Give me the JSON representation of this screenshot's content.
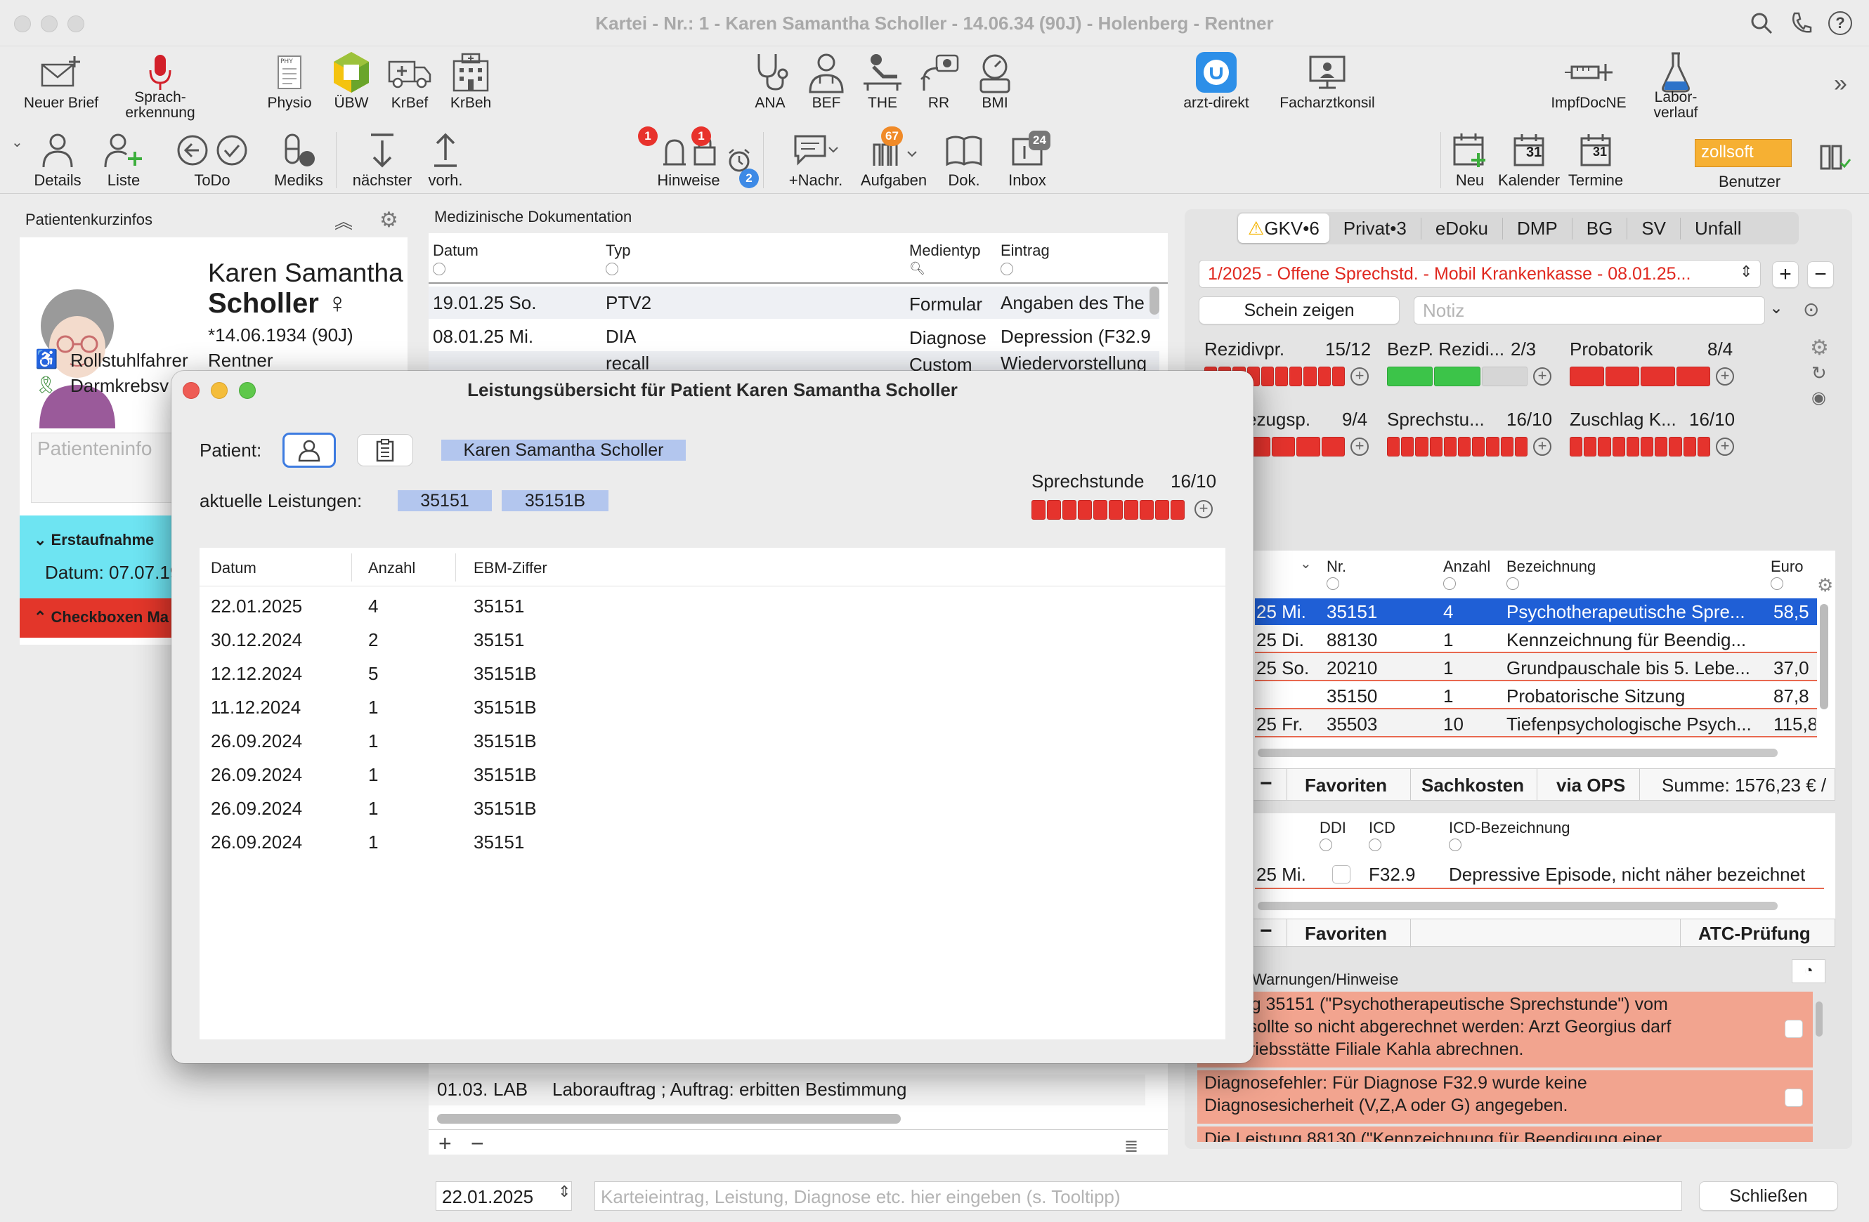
{
  "window": {
    "title": "Kartei - Nr.: 1 - Karen Samantha Scholler - 14.06.34 (90J) - Holenberg - Rentner"
  },
  "toolbar1": [
    {
      "label": "Neuer Brief",
      "icon": "envelope-plus-icon"
    },
    {
      "label": "Sprach-\nerkennung",
      "icon": "microphone-icon"
    },
    {
      "label": "Physio",
      "icon": "physio-doc-icon"
    },
    {
      "label": "ÜBW",
      "icon": "uebw-icon"
    },
    {
      "label": "KrBef",
      "icon": "ambulance-icon"
    },
    {
      "label": "KrBeh",
      "icon": "hospital-icon"
    },
    {
      "label": "ANA",
      "icon": "stethoscope-icon"
    },
    {
      "label": "BEF",
      "icon": "doctor-icon"
    },
    {
      "label": "THE",
      "icon": "therapy-icon"
    },
    {
      "label": "RR",
      "icon": "blood-pressure-icon"
    },
    {
      "label": "BMI",
      "icon": "bmi-icon"
    },
    {
      "label": "arzt-direkt",
      "icon": "arzt-direkt-icon"
    },
    {
      "label": "Facharztkonsil",
      "icon": "consult-icon"
    },
    {
      "label": "ImpfDocNE",
      "icon": "syringe-icon"
    },
    {
      "label": "Labor-\nverlauf",
      "icon": "flask-icon"
    }
  ],
  "toolbar2": [
    {
      "label": "Details"
    },
    {
      "label": "Liste"
    },
    {
      "label": "ToDo"
    },
    {
      "label": "Mediks"
    },
    {
      "label": "nächster"
    },
    {
      "label": "vorh."
    },
    {
      "label": "Hinweise"
    },
    {
      "label": "+Nachr."
    },
    {
      "label": "Aufgaben"
    },
    {
      "label": "Dok."
    },
    {
      "label": "Inbox"
    },
    {
      "label": "Neu"
    },
    {
      "label": "Kalender"
    },
    {
      "label": "Termine"
    },
    {
      "label": "Benutzer"
    }
  ],
  "badges": {
    "hinweise_a": "1",
    "hinweise_b": "1",
    "alarm": "2",
    "aufgaben": "67",
    "inbox": "24",
    "kalender_day": "31",
    "termine_day": "31"
  },
  "user_chip": "zollsoft",
  "patient_panel": {
    "title": "Patientenkurzinfos",
    "first_name": "Karen Samantha",
    "last_name": "Scholler ♀",
    "birth": "*14.06.1934 (90J)",
    "status": "Rentner",
    "flag1": "Rollstuhlfahrer",
    "flag2": "Darmkrebsv",
    "info_placeholder": "Patienteninfo",
    "section1": "Erstaufnahme",
    "section1_date": "Datum: 07.07.19",
    "section2": "Checkboxen Ma"
  },
  "med_doc": {
    "title": "Medizinische Dokumentation",
    "columns": [
      "Datum",
      "Typ",
      "Medientyp",
      "Eintrag"
    ],
    "rows": [
      [
        "19.01.25  So.",
        "PTV2",
        "Formular",
        "Angaben des The"
      ],
      [
        "08.01.25  Mi.",
        "DIA",
        "Diagnose",
        "Depression (F32.9"
      ],
      [
        "",
        "recall",
        "Custom",
        "Wiedervorstellung"
      ]
    ],
    "bottom_row": [
      "01.03.",
      "LAB",
      "Laborauftrag ; Auftrag: erbitten Bestimmung"
    ]
  },
  "billing": {
    "tabs": [
      "GKV•6",
      "Privat•3",
      "eDoku",
      "DMP",
      "BG",
      "SV",
      "Unfall"
    ],
    "schein": "1/2025 - Offene Sprechstd. - Mobil Krankenkasse - 08.01.25...",
    "schein_btn": "Schein zeigen",
    "notiz_placeholder": "Notiz",
    "counters": [
      {
        "label": "Rezidivpr.",
        "value": "15/12"
      },
      {
        "label": "BezP. Rezidi...",
        "value": "2/3"
      },
      {
        "label": "Probatorik",
        "value": "8/4"
      },
      {
        "label": "ezugsp.",
        "value": "9/4"
      },
      {
        "label": "Sprechstu...",
        "value": "16/10"
      },
      {
        "label": "Zuschlag K...",
        "value": "16/10"
      }
    ],
    "leist_columns": [
      "Nr.",
      "Anzahl",
      "Bezeichnung",
      "Euro"
    ],
    "leist_rows": [
      [
        "25  Mi.",
        "35151",
        "4",
        "Psychotherapeutische Spre...",
        "58,5"
      ],
      [
        "25  Di.",
        "88130",
        "1",
        "Kennzeichnung für Beendig...",
        ""
      ],
      [
        "25  So.",
        "20210",
        "1",
        "Grundpauschale bis 5. Lebe...",
        "37,0"
      ],
      [
        "",
        "35150",
        "1",
        "Probatorische Sitzung",
        "87,8"
      ],
      [
        "25  Fr.",
        "35503",
        "10",
        "Tiefenpsychologische Psych...",
        "115,8"
      ]
    ],
    "leist_footer": {
      "fav": "Favoriten",
      "sach": "Sachkosten",
      "ops": "via OPS",
      "sum": "Summe: 1576,23 € /"
    },
    "diag_columns": [
      "DDI",
      "ICD",
      "ICD-Bezeichnung"
    ],
    "diag_row": [
      "25  Mi.",
      "F32.9",
      "Depressive Episode, nicht näher bezeichnet"
    ],
    "diag_footer": {
      "fav": "Favoriten",
      "atc": "ATC-Prüfung"
    },
    "warn_title": "/Warnungen/Hinweise",
    "warnings": [
      "eistung 35151 (\"Psychotherapeutische Sprechstunde\") vom\n2025 sollte so nicht abgerechnet werden: Arzt Georgius darf\nin Betriebsstätte Filiale Kahla abrechnen.",
      "Diagnosefehler: Für Diagnose F32.9 wurde keine\nDiagnosesicherheit (V,Z,A oder G) angegeben.",
      "Die Leistung 88130 (\"Kennzeichnung für Beendigung einer"
    ]
  },
  "bottom": {
    "date": "22.01.2025",
    "entry_placeholder": "Karteieintrag, Leistung, Diagnose etc. hier eingeben (s. Tooltipp)",
    "close": "Schließen"
  },
  "modal": {
    "title": "Leistungsübersicht für Patient Karen Samantha Scholler",
    "patient_label": "Patient:",
    "patient_name": "Karen Samantha Scholler",
    "current_label": "aktuelle Leistungen:",
    "chips": [
      "35151",
      "35151B"
    ],
    "counter_label": "Sprechstunde",
    "counter_value": "16/10",
    "columns": [
      "Datum",
      "Anzahl",
      "EBM-Ziffer"
    ],
    "rows": [
      [
        "22.01.2025",
        "4",
        "35151"
      ],
      [
        "30.12.2024",
        "2",
        "35151"
      ],
      [
        "12.12.2024",
        "5",
        "35151B"
      ],
      [
        "11.12.2024",
        "1",
        "35151B"
      ],
      [
        "26.09.2024",
        "1",
        "35151B"
      ],
      [
        "26.09.2024",
        "1",
        "35151B"
      ],
      [
        "26.09.2024",
        "1",
        "35151B"
      ],
      [
        "26.09.2024",
        "1",
        "35151"
      ]
    ]
  }
}
